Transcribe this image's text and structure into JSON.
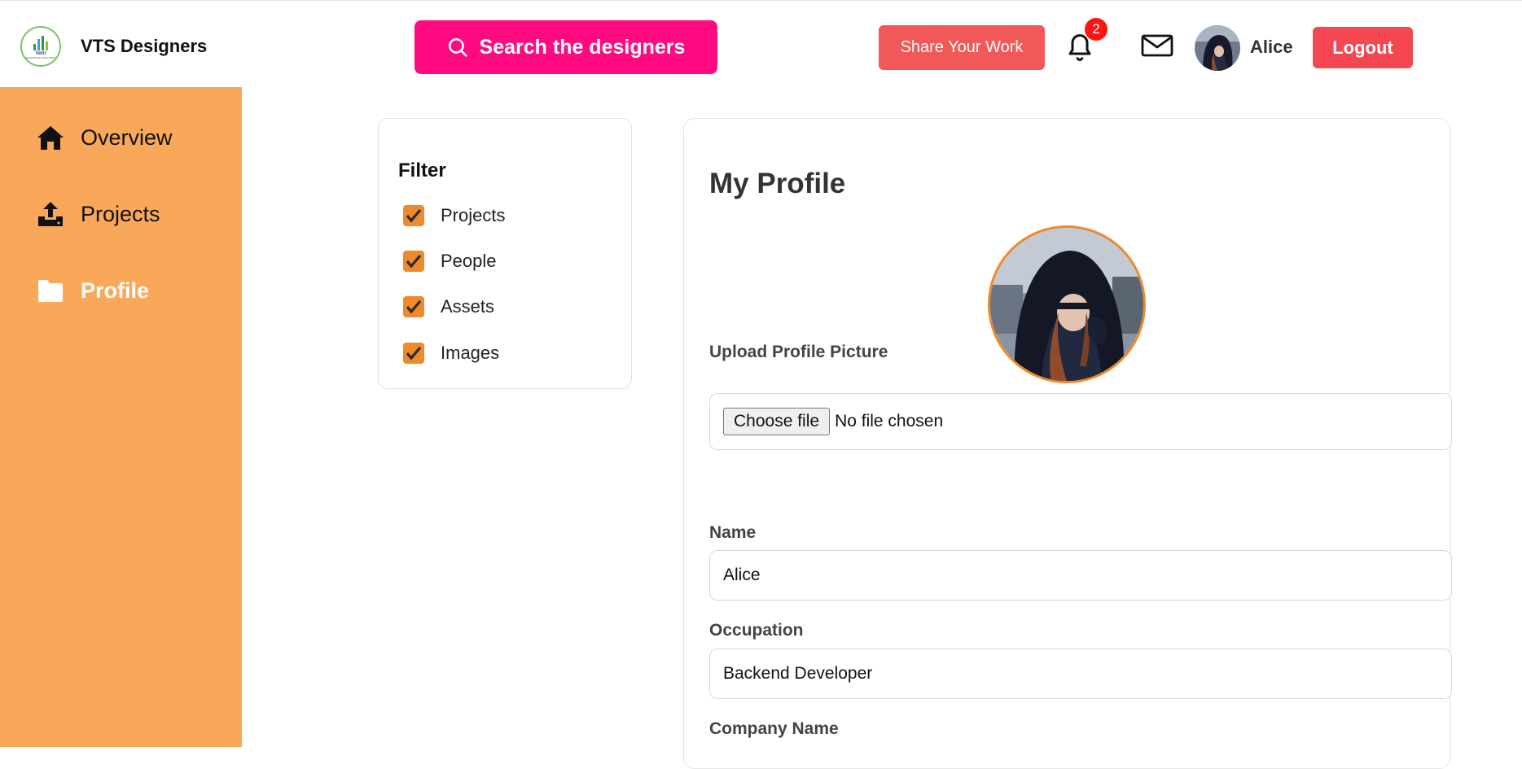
{
  "brand": {
    "name": "VTS Designers",
    "logo_text": "Vetri",
    "logo_subtext": "TECHNOLOGY SOLUTIONS"
  },
  "header": {
    "search_label": "Search the designers",
    "share_label": "Share Your Work",
    "notification_count": "2",
    "user_name": "Alice",
    "logout_label": "Logout"
  },
  "sidebar": {
    "items": [
      {
        "label": "Overview",
        "icon": "home-icon",
        "active": false
      },
      {
        "label": "Projects",
        "icon": "upload-icon",
        "active": false
      },
      {
        "label": "Profile",
        "icon": "folder-icon",
        "active": true
      }
    ]
  },
  "filter": {
    "title": "Filter",
    "options": [
      {
        "label": "Projects",
        "checked": true
      },
      {
        "label": "People",
        "checked": true
      },
      {
        "label": "Assets",
        "checked": true
      },
      {
        "label": "Images",
        "checked": true
      }
    ]
  },
  "profile": {
    "title": "My Profile",
    "upload_label": "Upload Profile Picture",
    "file_button": "Choose file",
    "file_status": "No file chosen",
    "name_label": "Name",
    "name_value": "Alice",
    "occupation_label": "Occupation",
    "occupation_value": "Backend Developer",
    "company_label": "Company Name"
  },
  "colors": {
    "sidebar": "#f9a85a",
    "search": "#ff0a80",
    "share": "#f35858",
    "logout": "#f44752",
    "checkbox": "#ee8a2a"
  }
}
